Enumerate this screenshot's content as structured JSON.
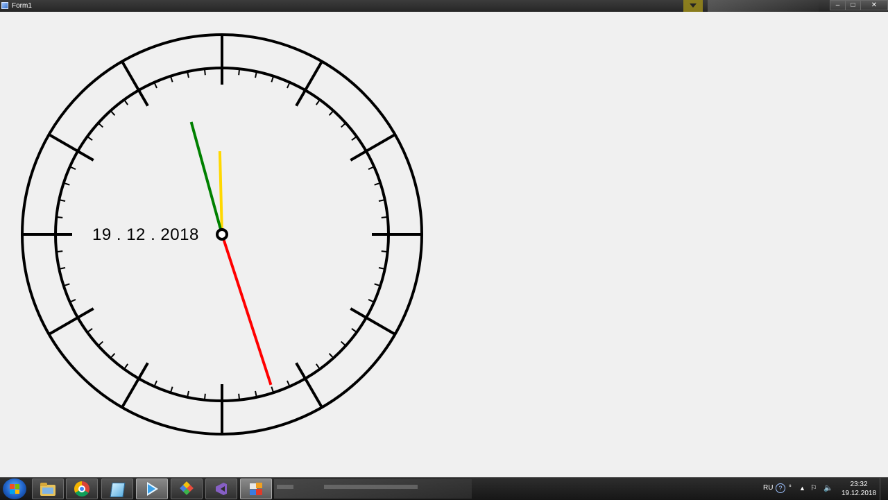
{
  "window": {
    "title": "Form1",
    "min_glyph": "–",
    "max_glyph": "□",
    "close_glyph": "✕"
  },
  "clock": {
    "date_text": "19 . 12 . 2018",
    "time": {
      "hour": 11,
      "minute": 57,
      "second": 27
    },
    "colors": {
      "hour_hand": "#ffd800",
      "minute_hand": "#008000",
      "second_hand": "#ff0000",
      "ink": "#000000"
    }
  },
  "taskbar": {
    "apps": [
      {
        "name": "file-explorer-icon"
      },
      {
        "name": "chrome-icon"
      },
      {
        "name": "notepad-icon"
      },
      {
        "name": "media-player-icon",
        "active": true
      },
      {
        "name": "paint-icon"
      },
      {
        "name": "visual-studio-icon"
      },
      {
        "name": "form-app-icon",
        "active": true
      }
    ],
    "tray": {
      "lang": "RU",
      "help": "?",
      "time": "23:32",
      "date": "19.12.2018"
    }
  }
}
